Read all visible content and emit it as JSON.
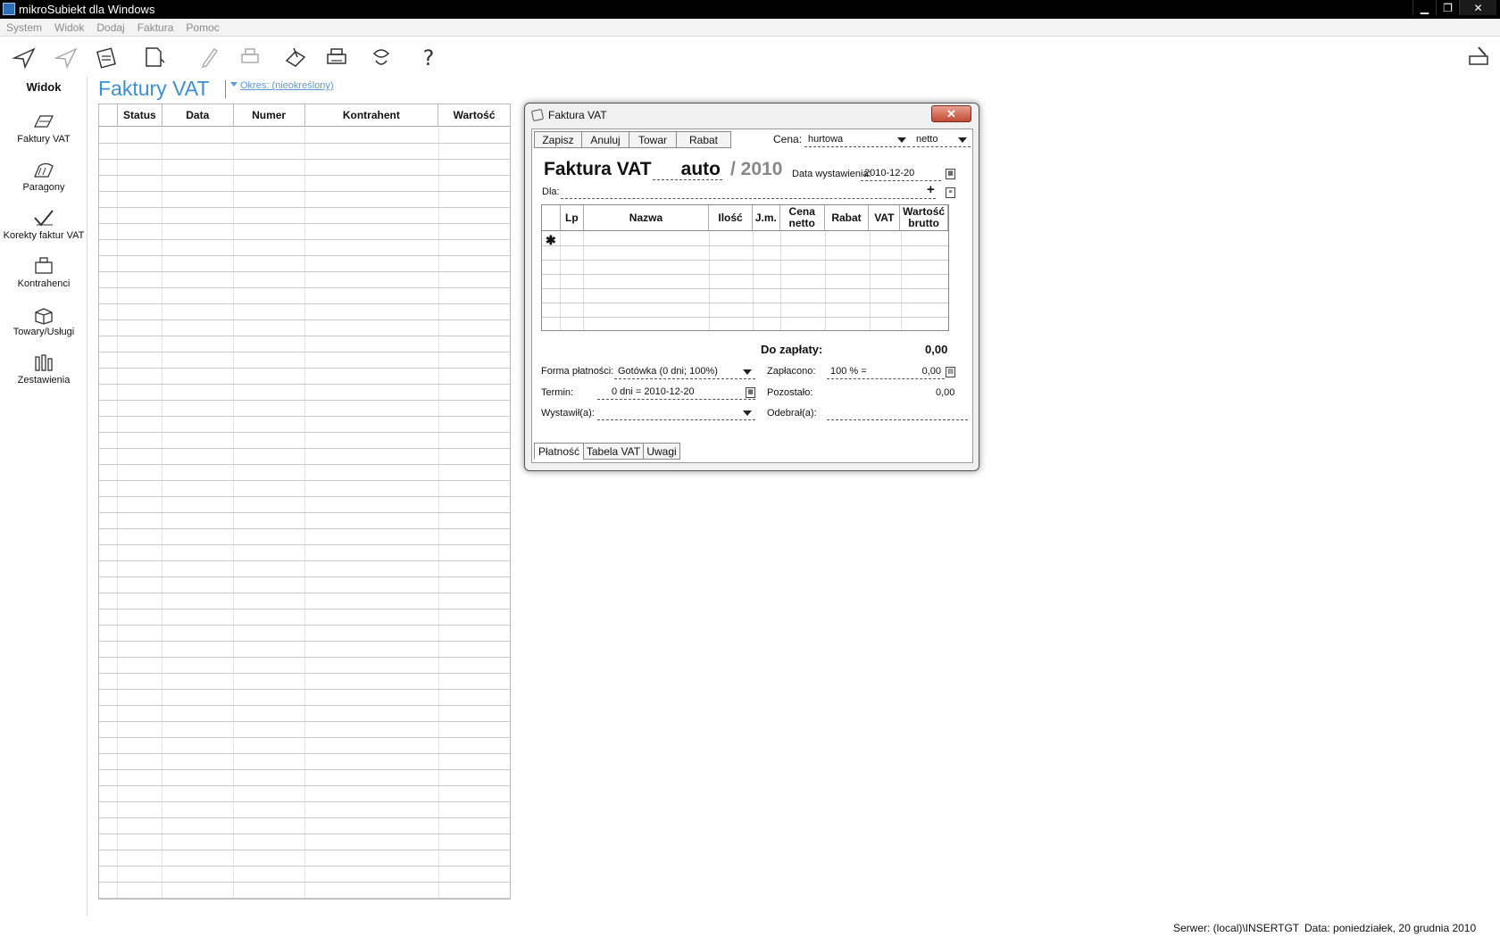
{
  "window": {
    "title": "mikroSubiekt dla Windows",
    "min": "▁",
    "max": "❐",
    "close": "✕"
  },
  "menu": [
    "System",
    "Widok",
    "Dodaj",
    "Faktura",
    "Pomoc"
  ],
  "sidebar": {
    "heading": "Widok",
    "items": [
      {
        "label": "Faktury VAT",
        "icon": "invoice-icon"
      },
      {
        "label": "Paragony",
        "icon": "receipt-icon"
      },
      {
        "label": "Korekty faktur VAT",
        "icon": "correction-icon"
      },
      {
        "label": "Kontrahenci",
        "icon": "contractors-icon"
      },
      {
        "label": "Towary/Usługi",
        "icon": "goods-icon"
      },
      {
        "label": "Zestawienia",
        "icon": "reports-icon"
      }
    ]
  },
  "list": {
    "title": "Faktury VAT",
    "period": "Okres: (nieokreślony)",
    "columns": [
      "Status",
      "Data",
      "Numer",
      "Kontrahent",
      "Wartość"
    ]
  },
  "dialog": {
    "title": "Faktura VAT",
    "close": "✕",
    "toolbar": [
      "Zapisz",
      "Anuluj",
      "Towar",
      "Rabat"
    ],
    "price_label": "Cena:",
    "price_type": "hurtowa",
    "price_basis": "netto",
    "doc_type": "Faktura VAT",
    "number": "auto",
    "year": "/ 2010",
    "issue_date_label": "Data wystawienia:",
    "issue_date": "2010-12-20",
    "for_label": "Dla:",
    "plus": "+",
    "columns": [
      "Lp",
      "Nazwa",
      "Ilość",
      "J.m.",
      "Cena netto",
      "Rabat",
      "VAT",
      "Wartość brutto"
    ],
    "new_row": "✱",
    "due_label": "Do zapłaty:",
    "due_value": "0,00",
    "payment_label": "Forma płatności:",
    "payment_value": "Gotówka (0 dni; 100%)",
    "paid_label": "Zapłacono:",
    "paid_percent": "100 % =",
    "paid_value": "0,00",
    "term_label": "Termin:",
    "term_value": "0 dni = 2010-12-20",
    "remaining_label": "Pozostało:",
    "remaining_value": "0,00",
    "issued_by_label": "Wystawił(a):",
    "received_by_label": "Odebrał(a):",
    "tabs": [
      "Płatność",
      "Tabela VAT",
      "Uwagi"
    ]
  },
  "status": {
    "server": "Serwer: (local)\\INSERTGT",
    "date": "Data: poniedziałek, 20 grudnia 2010"
  }
}
